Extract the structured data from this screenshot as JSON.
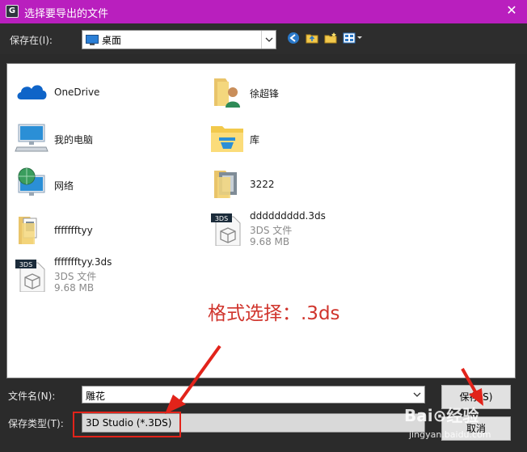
{
  "titlebar": {
    "title": "选择要导出的文件",
    "app_icon": "G",
    "close": "✕"
  },
  "toolbar": {
    "save_in_label": "保存在(I):",
    "location_value": "桌面",
    "icons": [
      "back-icon",
      "up-folder-icon",
      "new-folder-icon",
      "view-menu-icon"
    ]
  },
  "files": [
    {
      "name": "OneDrive",
      "icon": "cloud-icon"
    },
    {
      "name": "徐超锋",
      "icon": "user-folder-icon"
    },
    {
      "name": "我的电脑",
      "icon": "computer-icon"
    },
    {
      "name": "库",
      "icon": "library-icon"
    },
    {
      "name": "网络",
      "icon": "network-icon"
    },
    {
      "name": "3222",
      "icon": "folder-icon"
    },
    {
      "name": "ffffffftyy",
      "icon": "folder-icon"
    },
    {
      "name": "ddddddddd.3ds",
      "type": "3DS 文件",
      "size": "9.68 MB",
      "icon": "3ds-file-icon",
      "badge": "3DS"
    },
    {
      "name": "ffffffftyy.3ds",
      "type": "3DS 文件",
      "size": "9.68 MB",
      "icon": "3ds-file-icon",
      "badge": "3DS"
    }
  ],
  "annotation": "格式选择：.3ds",
  "bottom": {
    "filename_label": "文件名(N):",
    "filename_value": "雕花",
    "filetype_label": "保存类型(T):",
    "filetype_value": "3D Studio (*.3DS)",
    "save_button": "保存(S)",
    "cancel_button": "取消"
  },
  "watermark": {
    "brand": "Bai⊙经验",
    "url": "jingyan.baidu.com"
  },
  "colors": {
    "titlebar": "#b91fbe",
    "annotation": "#d0342c",
    "arrow": "#e2231a",
    "highlight_box": "#e2231a"
  }
}
